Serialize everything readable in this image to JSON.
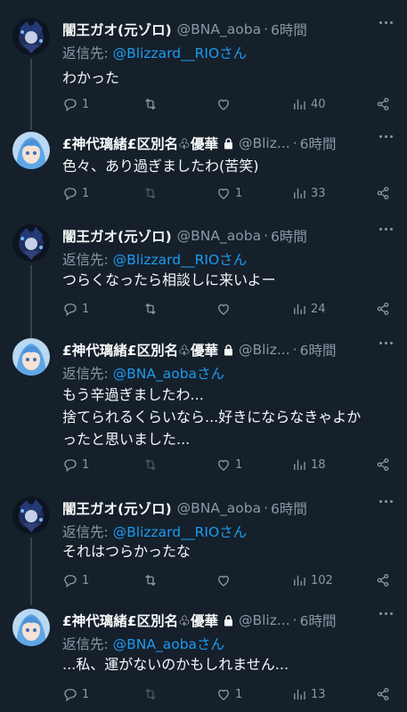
{
  "tweets": [
    {
      "author": "闇王ガオ(元ゾロ)",
      "handle": "@BNA_aoba",
      "time": "6時間",
      "reply_prefix": "返信先: ",
      "reply_to": "@Blizzard__RIOさん",
      "lines": [
        "わかった"
      ],
      "replies": "1",
      "retweets": "",
      "likes": "",
      "views": "40",
      "locked": false,
      "avatar": "dark-character"
    },
    {
      "author": "£神代璃緒£区別名♧優華",
      "handle": "@Bliz...",
      "time": "6時間",
      "reply_prefix": "",
      "reply_to": "",
      "lines": [
        "色々、あり過ぎましたわ(苦笑)"
      ],
      "replies": "1",
      "retweets": "",
      "likes": "1",
      "views": "33",
      "locked": true,
      "avatar": "blue-hair-girl"
    },
    {
      "author": "闇王ガオ(元ゾロ)",
      "handle": "@BNA_aoba",
      "time": "6時間",
      "reply_prefix": "返信先: ",
      "reply_to": "@Blizzard__RIOさん",
      "lines": [
        "つらくなったら相談しに来いよー"
      ],
      "replies": "1",
      "retweets": "",
      "likes": "",
      "views": "24",
      "locked": false,
      "avatar": "dark-character"
    },
    {
      "author": "£神代璃緒£区別名♧優華",
      "handle": "@Bliz...",
      "time": "6時間",
      "reply_prefix": "返信先: ",
      "reply_to": "@BNA_aobaさん",
      "lines": [
        "もう辛過ぎましたわ...",
        "捨てられるくらいなら...好きにならなきゃよか",
        "ったと思いました..."
      ],
      "replies": "1",
      "retweets": "",
      "likes": "1",
      "views": "18",
      "locked": true,
      "avatar": "blue-hair-girl"
    },
    {
      "author": "闇王ガオ(元ゾロ)",
      "handle": "@BNA_aoba",
      "time": "6時間",
      "reply_prefix": "返信先: ",
      "reply_to": "@Blizzard__RIOさん",
      "lines": [
        "それはつらかったな"
      ],
      "replies": "1",
      "retweets": "",
      "likes": "",
      "views": "102",
      "locked": false,
      "avatar": "dark-character"
    },
    {
      "author": "£神代璃緒£区別名♧優華",
      "handle": "@Bliz...",
      "time": "6時間",
      "reply_prefix": "返信先: ",
      "reply_to": "@BNA_aobaさん",
      "lines": [
        "...私、運がないのかもしれません..."
      ],
      "replies": "1",
      "retweets": "",
      "likes": "1",
      "views": "13",
      "locked": true,
      "avatar": "blue-hair-girl"
    }
  ],
  "colors": {
    "background": "#15202b",
    "text": "#f7f9f9",
    "muted": "#8b98a5",
    "link": "#1d9bf0",
    "thread_line": "#38444d"
  }
}
